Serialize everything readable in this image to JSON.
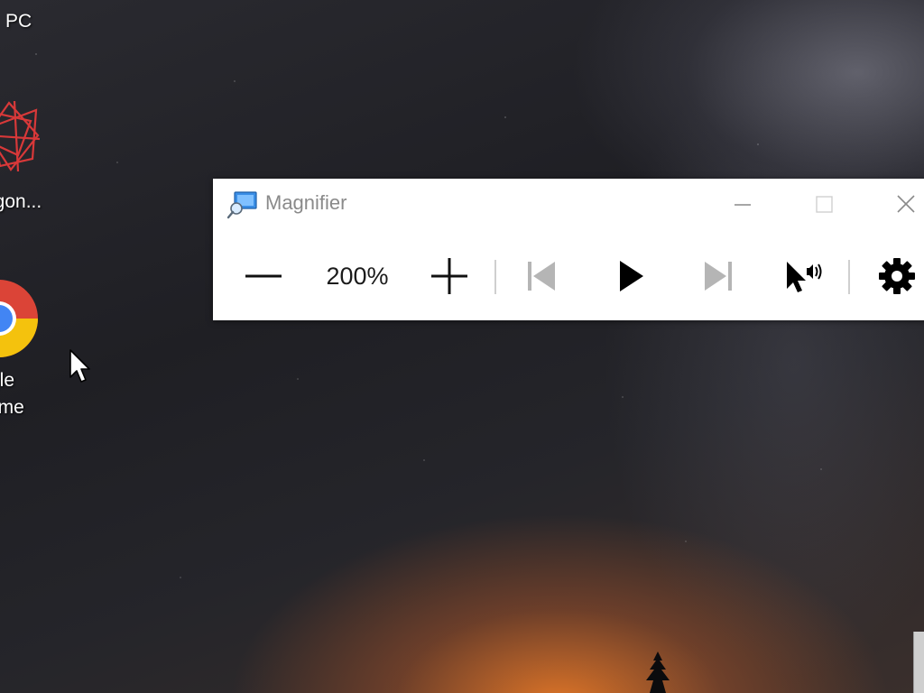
{
  "desktop": {
    "icons": [
      {
        "label": "PC",
        "icon": "this-pc-icon"
      },
      {
        "label": "agon...",
        "icon": "polygon-app-icon"
      },
      {
        "label_line1": "gle",
        "label_line2": "ome",
        "icon": "google-chrome-icon"
      }
    ]
  },
  "magnifier": {
    "title": "Magnifier",
    "zoom_level": "200%",
    "controls": {
      "zoom_out": "minus-icon",
      "zoom_in": "plus-icon",
      "previous": "skip-back-icon",
      "play": "play-icon",
      "next": "skip-forward-icon",
      "read_from_here": "read-from-cursor-icon",
      "settings": "gear-icon"
    },
    "window_buttons": [
      "minimize-icon",
      "maximize-icon",
      "close-icon"
    ]
  },
  "colors": {
    "window_bg": "#ffffff",
    "title_text": "#8a8a8a",
    "disabled_icon": "#b5b5b5",
    "enabled_icon": "#000000"
  }
}
